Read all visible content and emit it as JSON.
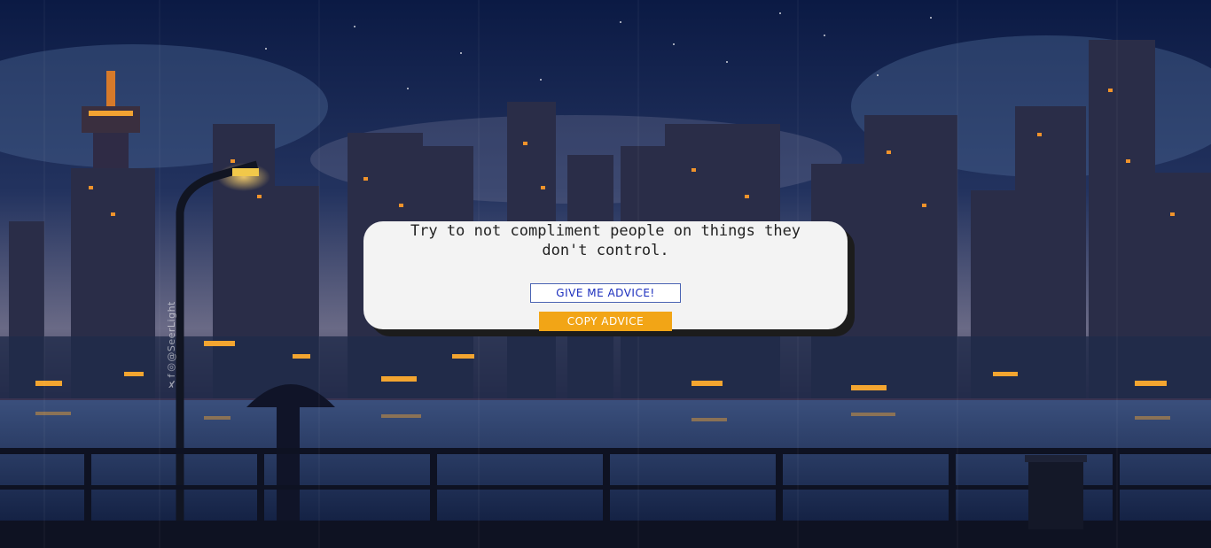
{
  "advice": {
    "text": "Try to not compliment people on things they don't control."
  },
  "buttons": {
    "give_advice_label": "GIVE ME ADVICE!",
    "copy_advice_label": "COPY ADVICE"
  },
  "background": {
    "signature": "✗f◎@SeerLight"
  },
  "colors": {
    "card_bg": "#f3f3f3",
    "give_button_text": "#1a2dbd",
    "copy_button_bg": "#f2a516"
  }
}
